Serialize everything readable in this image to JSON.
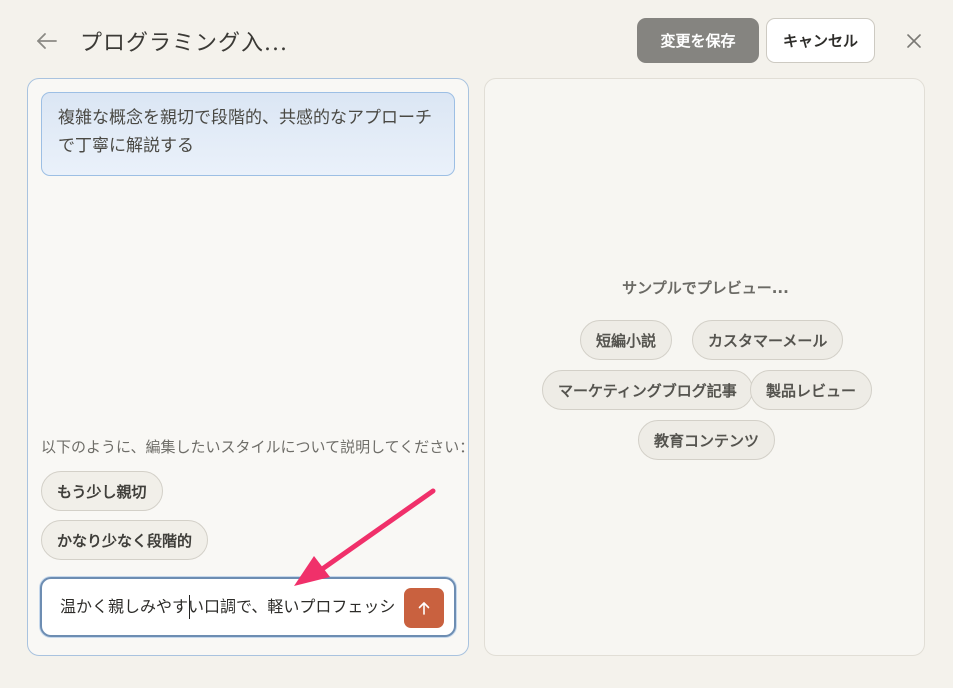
{
  "header": {
    "title": "プログラミング入...",
    "save_label": "変更を保存",
    "cancel_label": "キャンセル"
  },
  "editor": {
    "style_description": "複雑な概念を親切で段階的、共感的なアプローチで丁寧に解説する",
    "hint": "以下のように、編集したいスタイルについて説明してください：",
    "suggestions": [
      "もう少し親切",
      "かなり少なく段階的"
    ],
    "input_value": "温かく親しみやすい口調で、軽いプロフェッショナル"
  },
  "preview": {
    "label": "サンプルでプレビュー...",
    "options": [
      "短編小説",
      "カスタマーメール",
      "マーケティングブログ記事",
      "製品レビュー",
      "教育コンテンツ"
    ]
  },
  "colors": {
    "accent_send": "#c9613f",
    "annotation_arrow": "#f0306a"
  },
  "icons": {
    "back": "back-arrow-icon",
    "close": "close-icon",
    "send": "arrow-up-icon"
  }
}
